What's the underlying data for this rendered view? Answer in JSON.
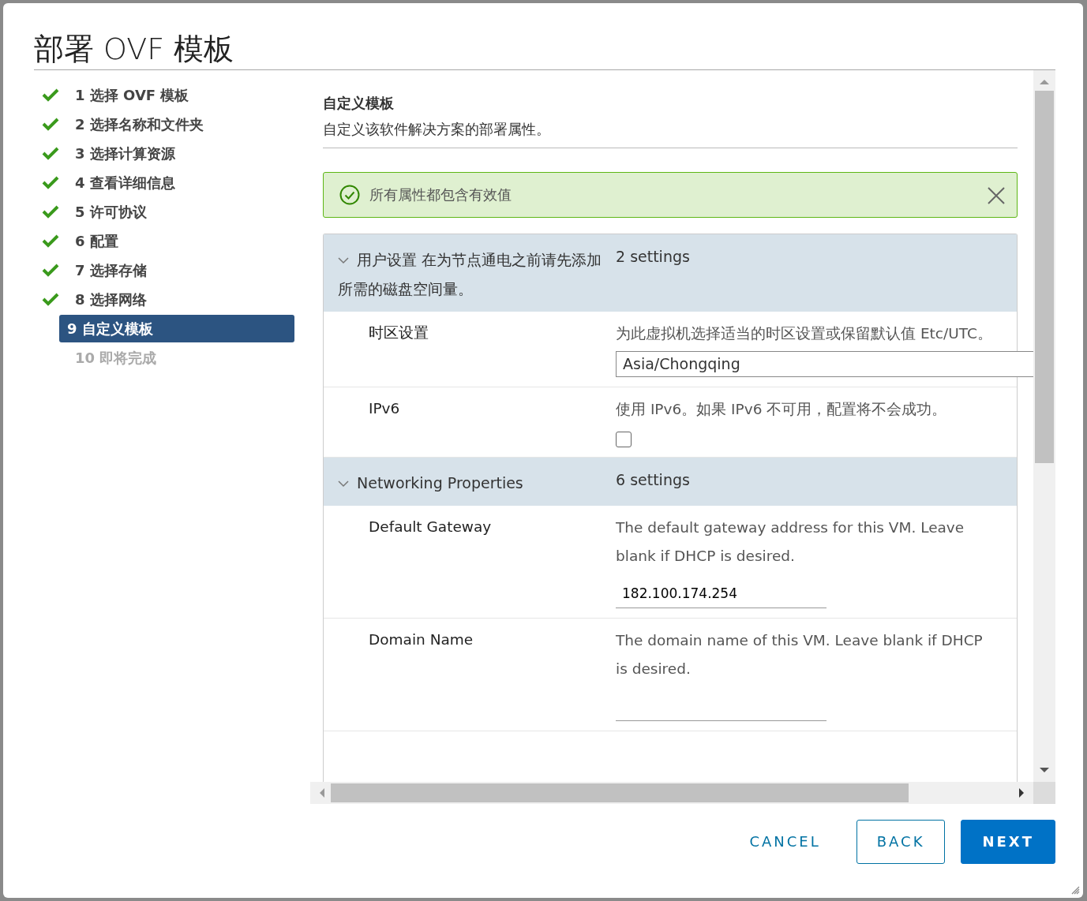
{
  "dialog": {
    "title": "部署 OVF 模板"
  },
  "steps": [
    {
      "label": "1 选择 OVF 模板",
      "completed": true,
      "selected": false
    },
    {
      "label": "2 选择名称和文件夹",
      "completed": true,
      "selected": false
    },
    {
      "label": "3 选择计算资源",
      "completed": true,
      "selected": false
    },
    {
      "label": "4 查看详细信息",
      "completed": true,
      "selected": false
    },
    {
      "label": "5 许可协议",
      "completed": true,
      "selected": false
    },
    {
      "label": "6 配置",
      "completed": true,
      "selected": false
    },
    {
      "label": "7 选择存储",
      "completed": true,
      "selected": false
    },
    {
      "label": "8 选择网络",
      "completed": true,
      "selected": false
    },
    {
      "label": "9 自定义模板",
      "completed": false,
      "selected": true
    },
    {
      "label": "10 即将完成",
      "completed": false,
      "selected": false
    }
  ],
  "page": {
    "title": "自定义模板",
    "subtitle": "自定义该软件解决方案的部署属性。"
  },
  "alert": {
    "message": "所有属性都包含有效值"
  },
  "sections": [
    {
      "title": "用户设置 在为节点通电之前请先添加所需的磁盘空间量。",
      "count": "2 settings",
      "expanded": true,
      "properties": [
        {
          "kind": "text",
          "label": "时区设置",
          "description": "为此虚拟机选择适当的时区设置或保留默认值 Etc/UTC。",
          "value": "Asia/Chongqing"
        },
        {
          "kind": "checkbox",
          "label": "IPv6",
          "description": "使用 IPv6。如果 IPv6 不可用，配置将不会成功。",
          "checked": false
        }
      ]
    },
    {
      "title": "Networking Properties",
      "count": "6 settings",
      "expanded": true,
      "properties": [
        {
          "kind": "underline",
          "label": "Default Gateway",
          "description": "The default gateway address for this VM. Leave blank if DHCP is desired.",
          "value": "182.100.174.254"
        },
        {
          "kind": "underline",
          "label": "Domain Name",
          "description": "The domain name of this VM. Leave blank if DHCP is desired."
        }
      ]
    }
  ],
  "buttons": [
    {
      "label": "CANCEL",
      "kind": "link"
    },
    {
      "label": "BACK",
      "kind": "outline"
    },
    {
      "label": "NEXT",
      "kind": "primary"
    }
  ]
}
